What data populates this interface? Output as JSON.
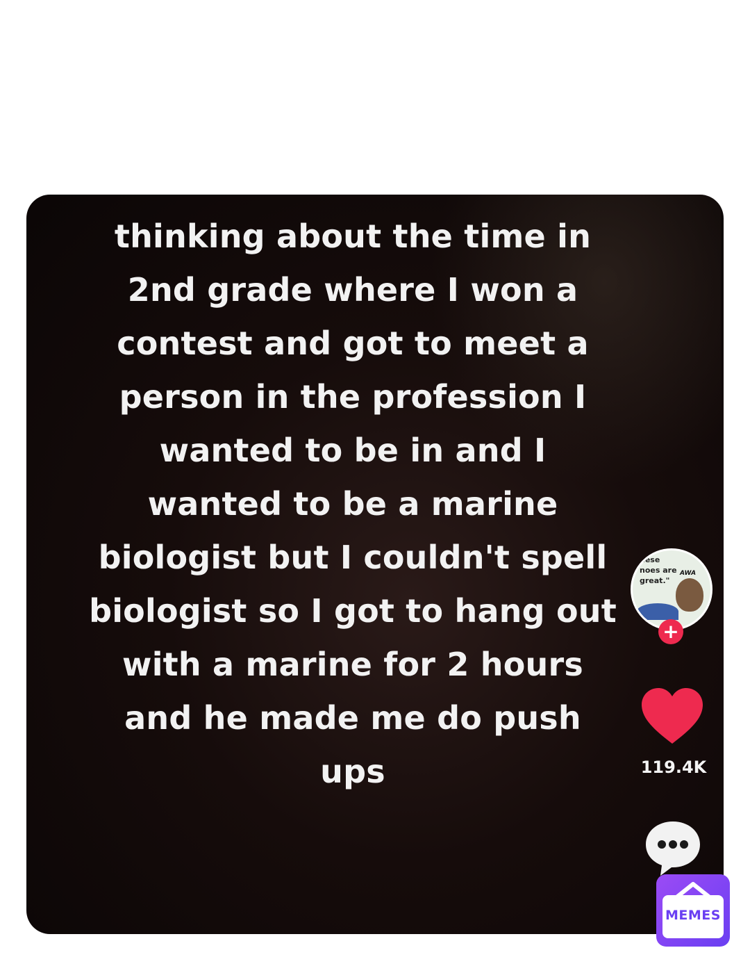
{
  "post": {
    "caption": "thinking about the time in 2nd grade where I won a contest and got to meet a person in the profession I wanted to be in and I wanted to be a marine biologist but I couldn't spell biologist so I got to hang out with a marine for 2 hours and he made me do push ups"
  },
  "sidebar": {
    "avatar_text": "hese noes are great.\"",
    "avatar_logo": "AWA",
    "follow_icon": "plus-icon",
    "like_icon": "heart-icon",
    "like_count": "119.4K",
    "comment_icon": "comment-bubble-icon"
  },
  "watermark": {
    "label": "MEMES"
  },
  "colors": {
    "heart": "#ee2a4f",
    "follow": "#ee2a4f",
    "watermark": "#6a3ff2",
    "card_background": "#0b0606"
  }
}
